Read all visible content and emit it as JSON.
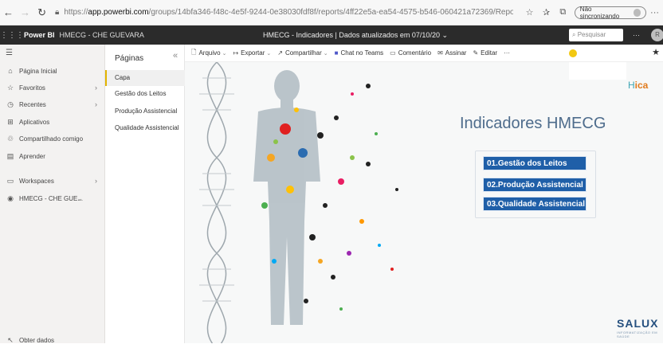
{
  "browser": {
    "url_protocol": "https://",
    "url_host": "app.powerbi.com",
    "url_path": "/groups/14bfa346-f48c-4e5f-9244-0e38030fdf8f/reports/4ff22e5a-ea54-4575-b546-060421a72369/ReportSectionb...",
    "sync_label": "Não sincronizando"
  },
  "header": {
    "app_name": "Power BI",
    "workspace": "HMECG - CHE GUEVARA",
    "report_title": "HMECG - Indicadores  |  Dados atualizados em 07/10/20",
    "search_placeholder": "Pesquisar",
    "more": "···"
  },
  "left_nav": {
    "items": [
      {
        "label": "Página Inicial",
        "icon": "home-icon"
      },
      {
        "label": "Favoritos",
        "icon": "star-icon"
      },
      {
        "label": "Recentes",
        "icon": "clock-icon"
      },
      {
        "label": "Aplicativos",
        "icon": "apps-icon"
      },
      {
        "label": "Compartilhado comigo",
        "icon": "shared-icon"
      },
      {
        "label": "Aprender",
        "icon": "book-icon"
      },
      {
        "label": "Workspaces",
        "icon": "workspaces-icon"
      },
      {
        "label": "HMECG - CHE GUE...",
        "icon": "workspace-avatar-icon"
      }
    ],
    "get_data": "Obter dados"
  },
  "pages": {
    "title": "Páginas",
    "items": [
      "Capa",
      "Gestão dos Leitos",
      "Produção Assistencial",
      "Qualidade Assistencial"
    ]
  },
  "toolbar": {
    "arquivo": "Arquivo",
    "exportar": "Exportar",
    "compartilhar": "Compartilhar",
    "chat_teams": "Chat no Teams",
    "comentario": "Comentário",
    "assinar": "Assinar",
    "editar": "Editar",
    "more": "···"
  },
  "report": {
    "title": "Indicadores HMECG",
    "buttons": [
      "01.Gestão dos Leitos",
      "02.Produção Assistencial",
      "03.Qualidade Assistencial"
    ],
    "logo_top_left": "H",
    "logo_top_right": "ica",
    "logo_bottom": "SALUX",
    "logo_bottom_sub": "INFORMATIZAÇÃO EM SAÚDE"
  },
  "colors": {
    "accent": "#f2c811",
    "header_bg": "#2b2b2b",
    "button_bg": "#1f5fa8",
    "title_color": "#4e6c8c"
  }
}
